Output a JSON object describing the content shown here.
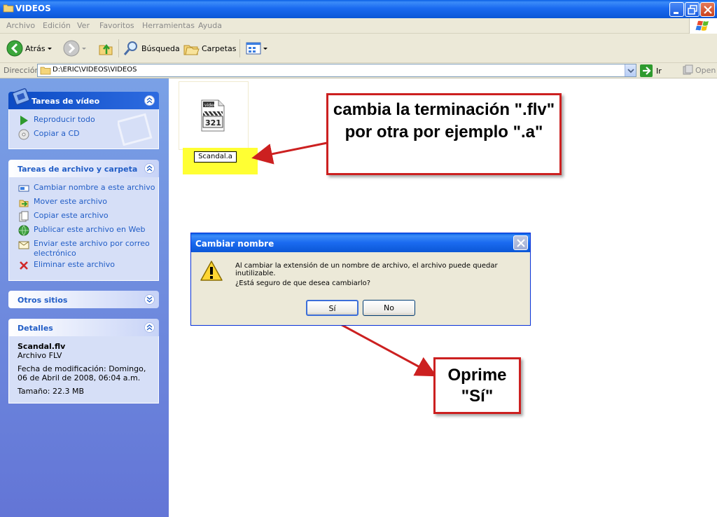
{
  "window": {
    "title": "VIDEOS"
  },
  "menu": [
    "Archivo",
    "Edición",
    "Ver",
    "Favoritos",
    "Herramientas",
    "Ayuda"
  ],
  "toolbar": {
    "back": "Atrás",
    "search": "Búsqueda",
    "folders": "Carpetas"
  },
  "address": {
    "label": "Dirección",
    "path": "D:\\ERIC\\VIDEOS\\VIDEOS",
    "go": "Ir",
    "open": "Open"
  },
  "panels": {
    "video_tasks": {
      "title": "Tareas de vídeo",
      "items": [
        "Reproducir todo",
        "Copiar a CD"
      ]
    },
    "file_tasks": {
      "title": "Tareas de archivo y carpeta",
      "items": [
        "Cambiar nombre a este archivo",
        "Mover este archivo",
        "Copiar este archivo",
        "Publicar este archivo en Web",
        "Enviar este archivo por correo electrónico",
        "Eliminar este archivo"
      ]
    },
    "other_places": {
      "title": "Otros sitios"
    },
    "details": {
      "title": "Detalles",
      "name": "Scandal.flv",
      "type": "Archivo FLV",
      "modified": "Fecha de modificación: Domingo, 06 de Abril de 2008, 06:04 a.m.",
      "size": "Tamaño: 22.3 MB"
    }
  },
  "file": {
    "icon_label": "video",
    "icon_number": "321",
    "rename_value": "Scandal.a"
  },
  "callouts": {
    "top": "cambia la terminación \".flv\" por otra por ejemplo \".a\"",
    "bottom": "Oprime \"Sí\""
  },
  "dialog": {
    "title": "Cambiar nombre",
    "message": "Al cambiar la extensión de un nombre de archivo, el archivo puede quedar inutilizable.",
    "question": "¿Está seguro de que desea cambiarlo?",
    "yes": "Sí",
    "no": "No"
  },
  "colors": {
    "xp_blue": "#0b57d6",
    "pane": "#6375d6",
    "callout_border": "#cc2020",
    "highlight": "#ffff33"
  }
}
